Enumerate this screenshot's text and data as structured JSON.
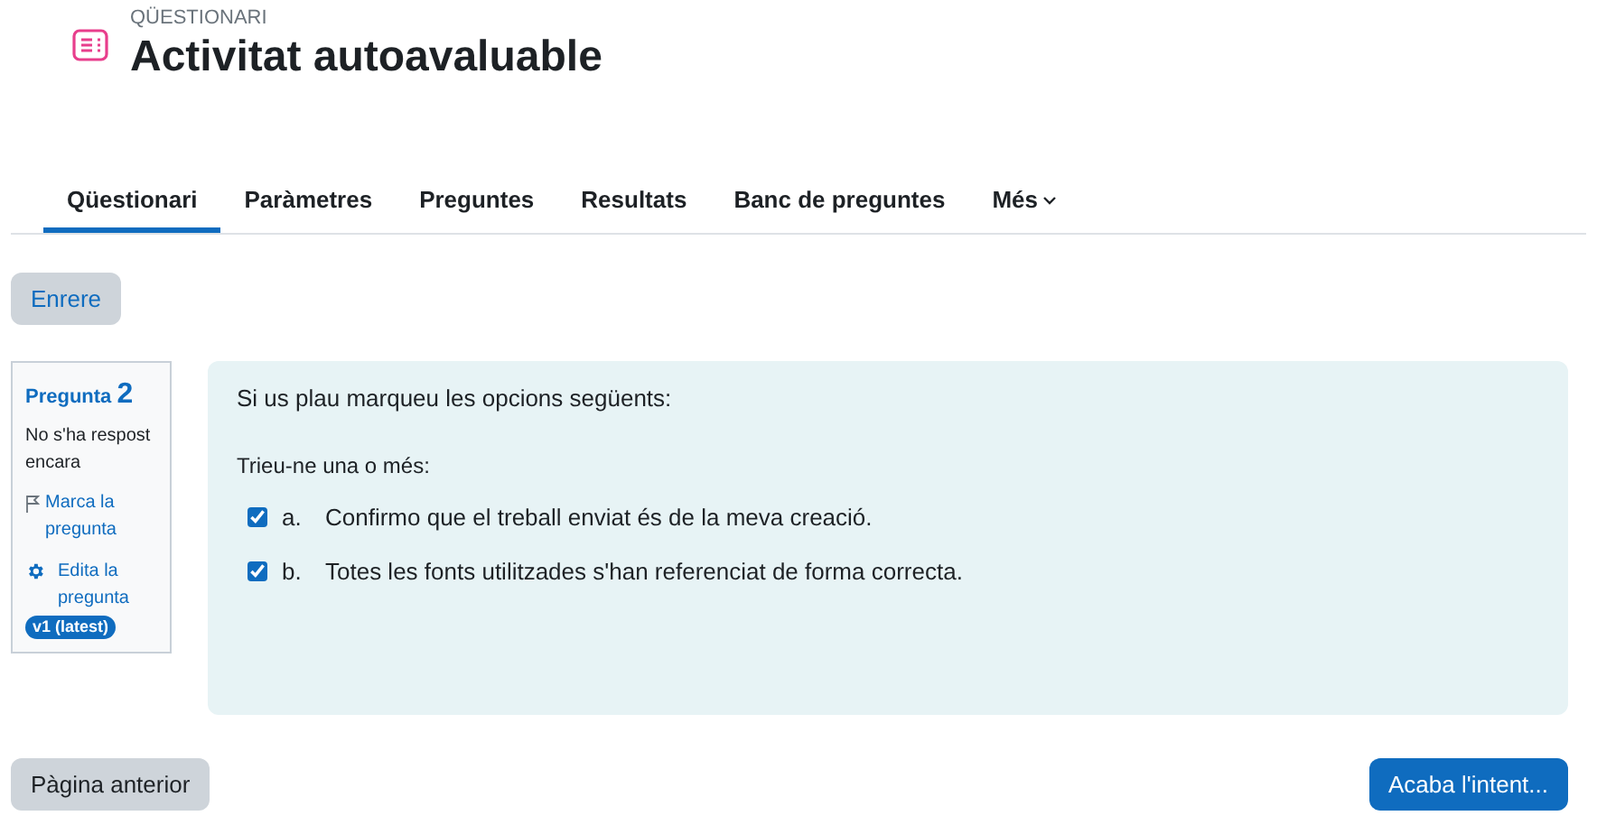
{
  "header": {
    "kicker": "QÜESTIONARI",
    "title": "Activitat autoavaluable"
  },
  "tabs": [
    {
      "label": "Qüestionari",
      "selected": true
    },
    {
      "label": "Paràmetres",
      "selected": false
    },
    {
      "label": "Preguntes",
      "selected": false
    },
    {
      "label": "Resultats",
      "selected": false
    },
    {
      "label": "Banc de preguntes",
      "selected": false
    },
    {
      "label": "Més",
      "selected": false,
      "kind": "menu"
    }
  ],
  "back_button": "Enrere",
  "question_info": {
    "label": "Pregunta",
    "number": "2",
    "status": "No s'ha respost encara",
    "flag_link": "Marca la pregunta",
    "edit_link": "Edita la pregunta",
    "version": "v1 (latest)"
  },
  "question": {
    "text": "Si us plau marqueu les opcions següents:",
    "prompt": "Trieu-ne una o més:",
    "options": [
      {
        "letter": "a.",
        "text": "Confirmo que el treball enviat és de la meva creació.",
        "checked": true
      },
      {
        "letter": "b.",
        "text": "Totes les fonts utilitzades s'han referenciat de forma correcta.",
        "checked": true
      }
    ]
  },
  "buttons": {
    "previous": "Pàgina anterior",
    "finish": "Acaba l'intent..."
  }
}
